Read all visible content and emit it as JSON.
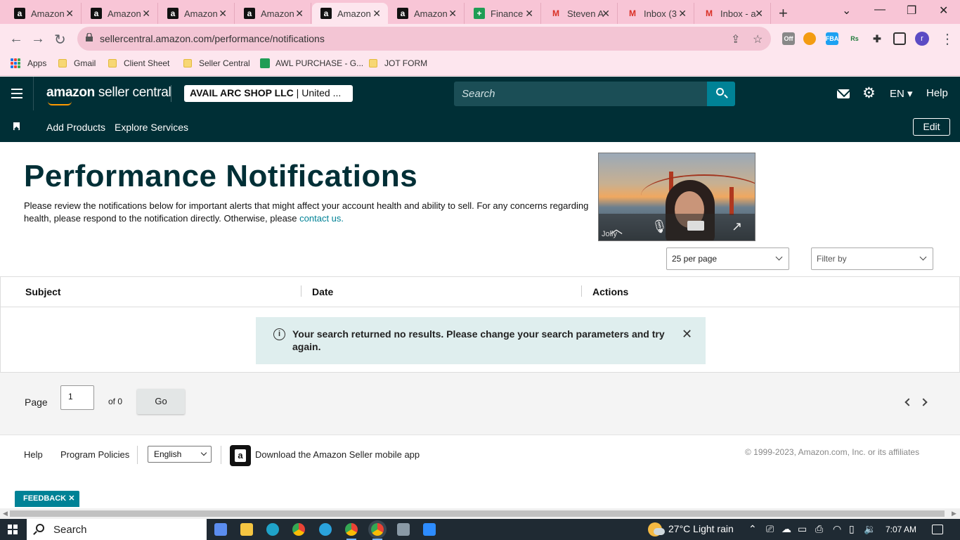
{
  "browser": {
    "tabs": [
      {
        "label": "Amazon",
        "icon": "amazon-icon"
      },
      {
        "label": "Amazon",
        "icon": "amazon-icon"
      },
      {
        "label": "Amazon",
        "icon": "amazon-icon"
      },
      {
        "label": "Amazon",
        "icon": "amazon-icon"
      },
      {
        "label": "Amazon",
        "icon": "amazon-icon",
        "active": true
      },
      {
        "label": "Amazon",
        "icon": "amazon-icon"
      },
      {
        "label": "Finance",
        "icon": "sheets-icon"
      },
      {
        "label": "Steven A",
        "icon": "gmail-icon"
      },
      {
        "label": "Inbox (3",
        "icon": "gmail-icon"
      },
      {
        "label": "Inbox - a",
        "icon": "gmail-icon"
      }
    ],
    "new_tab": "+",
    "url": "sellercentral.amazon.com/performance/notifications",
    "bookmarks": [
      {
        "label": "Apps",
        "icon": "apps-grid-icon"
      },
      {
        "label": "Gmail",
        "icon": "folder-icon"
      },
      {
        "label": "Client Sheet",
        "icon": "folder-icon"
      },
      {
        "label": "Seller Central",
        "icon": "folder-icon"
      },
      {
        "label": "AWL PURCHASE - G...",
        "icon": "sheets-icon"
      },
      {
        "label": "JOT FORM",
        "icon": "folder-icon"
      }
    ],
    "extensions": {
      "off_badge": "Off",
      "fba": "FBA",
      "rs": "Rs",
      "profile_initial": "r"
    }
  },
  "header": {
    "logo_bold": "amazon",
    "logo_light": " seller central",
    "account_name": "AVAIL ARC SHOP LLC",
    "account_region": " | United ...",
    "search_placeholder": "Search",
    "language": "EN",
    "help": "Help"
  },
  "nav": {
    "links": [
      "Add Products",
      "Explore Services"
    ],
    "edit": "Edit"
  },
  "main": {
    "title": "Performance Notifications",
    "description": "Please review the notifications below for important alerts that might affect your account health and ability to sell. For any concerns regarding health, please respond to the notification directly. Otherwise, please ",
    "contact_link": "contact us.",
    "per_page": "25 per page",
    "filter": "Filter by",
    "columns": [
      "Subject",
      "Date",
      "Actions"
    ],
    "empty_message": "Your search returned no results. Please change your search parameters and try again.",
    "video_call": {
      "participant": "Jolly"
    }
  },
  "pagination": {
    "page_label": "Page",
    "page_value": "1",
    "of_label": "of 0",
    "go": "Go"
  },
  "footer": {
    "help": "Help",
    "policies": "Program Policies",
    "language": "English",
    "app_text": "Download the Amazon Seller mobile app",
    "copyright": "© 1999-2023, Amazon.com, Inc. or its affiliates",
    "feedback": "FEEDBACK"
  },
  "taskbar": {
    "search": "Search",
    "weather": "27°C  Light rain",
    "time": "7:07 AM"
  },
  "colors": {
    "brand_dark": "#002f36",
    "accent_teal": "#008296",
    "browser_pink": "#f8c5d6"
  }
}
